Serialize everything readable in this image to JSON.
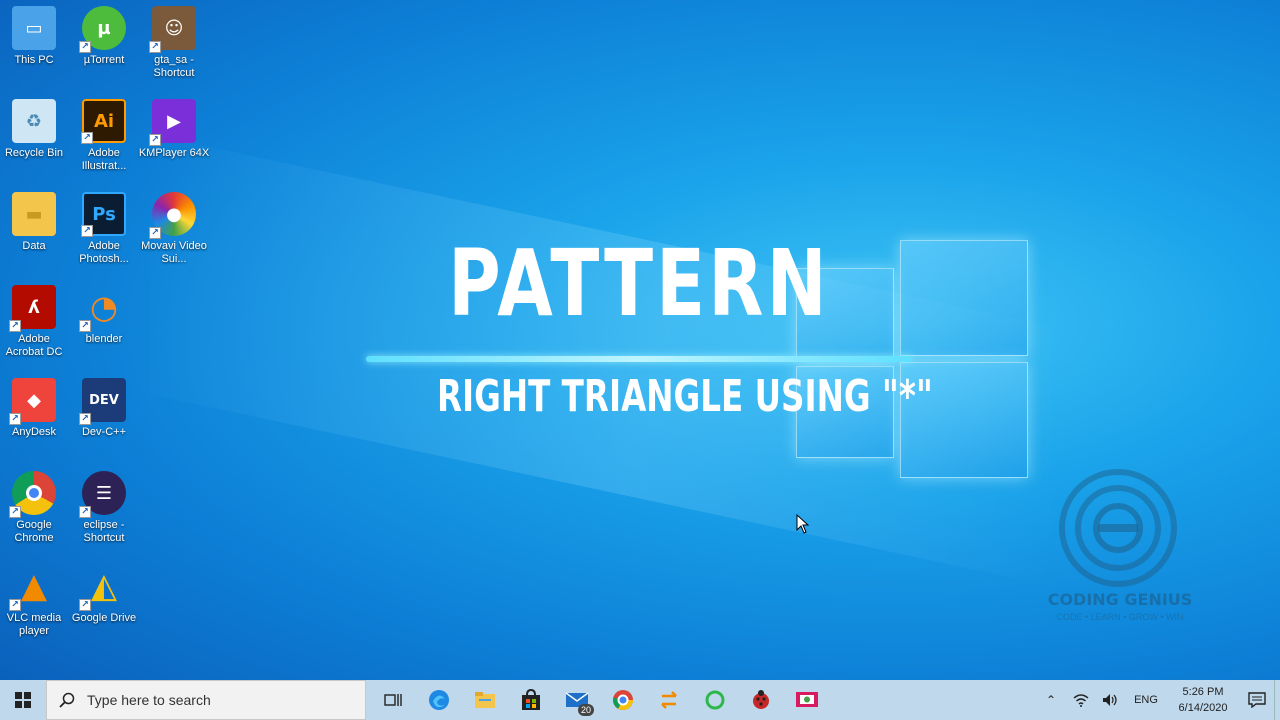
{
  "desktop": {
    "icons": [
      {
        "label": "This PC",
        "icon": "this-pc-icon",
        "color": "#4aa3e8"
      },
      {
        "label": "µTorrent",
        "icon": "utorrent-icon",
        "color": "#4dbb3c"
      },
      {
        "label": "gta_sa - Shortcut",
        "icon": "gta-icon",
        "color": "#7a5a3a"
      },
      {
        "label": "Recycle Bin",
        "icon": "recycle-bin-icon",
        "color": "#cfe6f5"
      },
      {
        "label": "Adobe Illustrat...",
        "icon": "illustrator-icon",
        "color": "#2d1a00"
      },
      {
        "label": "KMPlayer 64X",
        "icon": "kmplayer-icon",
        "color": "#7a2fd8"
      },
      {
        "label": "Data",
        "icon": "folder-icon",
        "color": "#f3c64b"
      },
      {
        "label": "Adobe Photosh...",
        "icon": "photoshop-icon",
        "color": "#0a1d33"
      },
      {
        "label": "Movavi Video Sui...",
        "icon": "movavi-icon",
        "color": "#ffffff"
      },
      {
        "label": "Adobe Acrobat DC",
        "icon": "acrobat-icon",
        "color": "#b30b00"
      },
      {
        "label": "blender",
        "icon": "blender-icon",
        "color": "#f08a24"
      },
      {
        "label": "AnyDesk",
        "icon": "anydesk-icon",
        "color": "#ef443b"
      },
      {
        "label": "Dev-C++",
        "icon": "devcpp-icon",
        "color": "#1b3c78"
      },
      {
        "label": "Google Chrome",
        "icon": "chrome-icon",
        "color": "#db4437"
      },
      {
        "label": "eclipse - Shortcut",
        "icon": "eclipse-icon",
        "color": "#2c2255"
      },
      {
        "label": "VLC media player",
        "icon": "vlc-icon",
        "color": "#f28a00"
      },
      {
        "label": "Google Drive",
        "icon": "google-drive-icon",
        "color": "#f4c20d"
      }
    ]
  },
  "overlay": {
    "title": "PATTERN",
    "subtitle": "RIGHT TRIANGLE USING \"*\""
  },
  "watermark": {
    "name": "CODING GENIUS",
    "tagline": "CODE • LEARN • GROW • WIN"
  },
  "taskbar": {
    "search_placeholder": "Type here to search",
    "apps": [
      {
        "name": "task-view",
        "icon": "task-view-icon"
      },
      {
        "name": "edge",
        "icon": "edge-icon"
      },
      {
        "name": "file-explorer",
        "icon": "file-explorer-icon"
      },
      {
        "name": "store",
        "icon": "store-icon"
      },
      {
        "name": "mail",
        "icon": "mail-icon",
        "badge": "20"
      },
      {
        "name": "chrome",
        "icon": "chrome-icon"
      },
      {
        "name": "sync",
        "icon": "sync-icon"
      },
      {
        "name": "circle-app",
        "icon": "circle-app-icon"
      },
      {
        "name": "ladybug-app",
        "icon": "ladybug-icon"
      },
      {
        "name": "recorder-app",
        "icon": "screen-recorder-icon"
      }
    ],
    "tray": {
      "language": "ENG",
      "time": "5:26 PM",
      "date": "6/14/2020"
    }
  }
}
